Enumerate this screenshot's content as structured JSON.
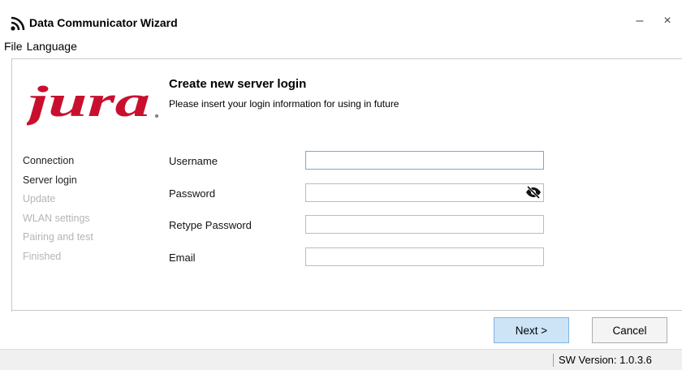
{
  "window": {
    "title": "Data Communicator Wizard",
    "icon": "rss-feed-icon",
    "minimize": "–",
    "close": "×"
  },
  "menu": {
    "items": [
      {
        "label": "File"
      },
      {
        "label": "Language"
      }
    ]
  },
  "brand": {
    "logo_text": "jura",
    "color": "#c8102e"
  },
  "page": {
    "heading": "Create new server login",
    "subheading": "Please insert your login information for using in future"
  },
  "steps": [
    {
      "label": "Connection",
      "enabled": true
    },
    {
      "label": "Server login",
      "enabled": true
    },
    {
      "label": "Update",
      "enabled": false
    },
    {
      "label": "WLAN settings",
      "enabled": false
    },
    {
      "label": "Pairing and test",
      "enabled": false
    },
    {
      "label": "Finished",
      "enabled": false
    }
  ],
  "form": {
    "username": {
      "label": "Username",
      "value": ""
    },
    "password": {
      "label": "Password",
      "value": "",
      "toggle_icon": "eye-slash-icon"
    },
    "retype_password": {
      "label": "Retype Password",
      "value": ""
    },
    "email": {
      "label": "Email",
      "value": ""
    }
  },
  "buttons": {
    "next": "Next >",
    "cancel": "Cancel"
  },
  "status": {
    "version": "SW Version:  1.0.3.6"
  },
  "colors": {
    "next_button_bg": "#cde4f7",
    "next_button_border": "#7fb3e0",
    "disabled_step": "#b5b5b5"
  }
}
